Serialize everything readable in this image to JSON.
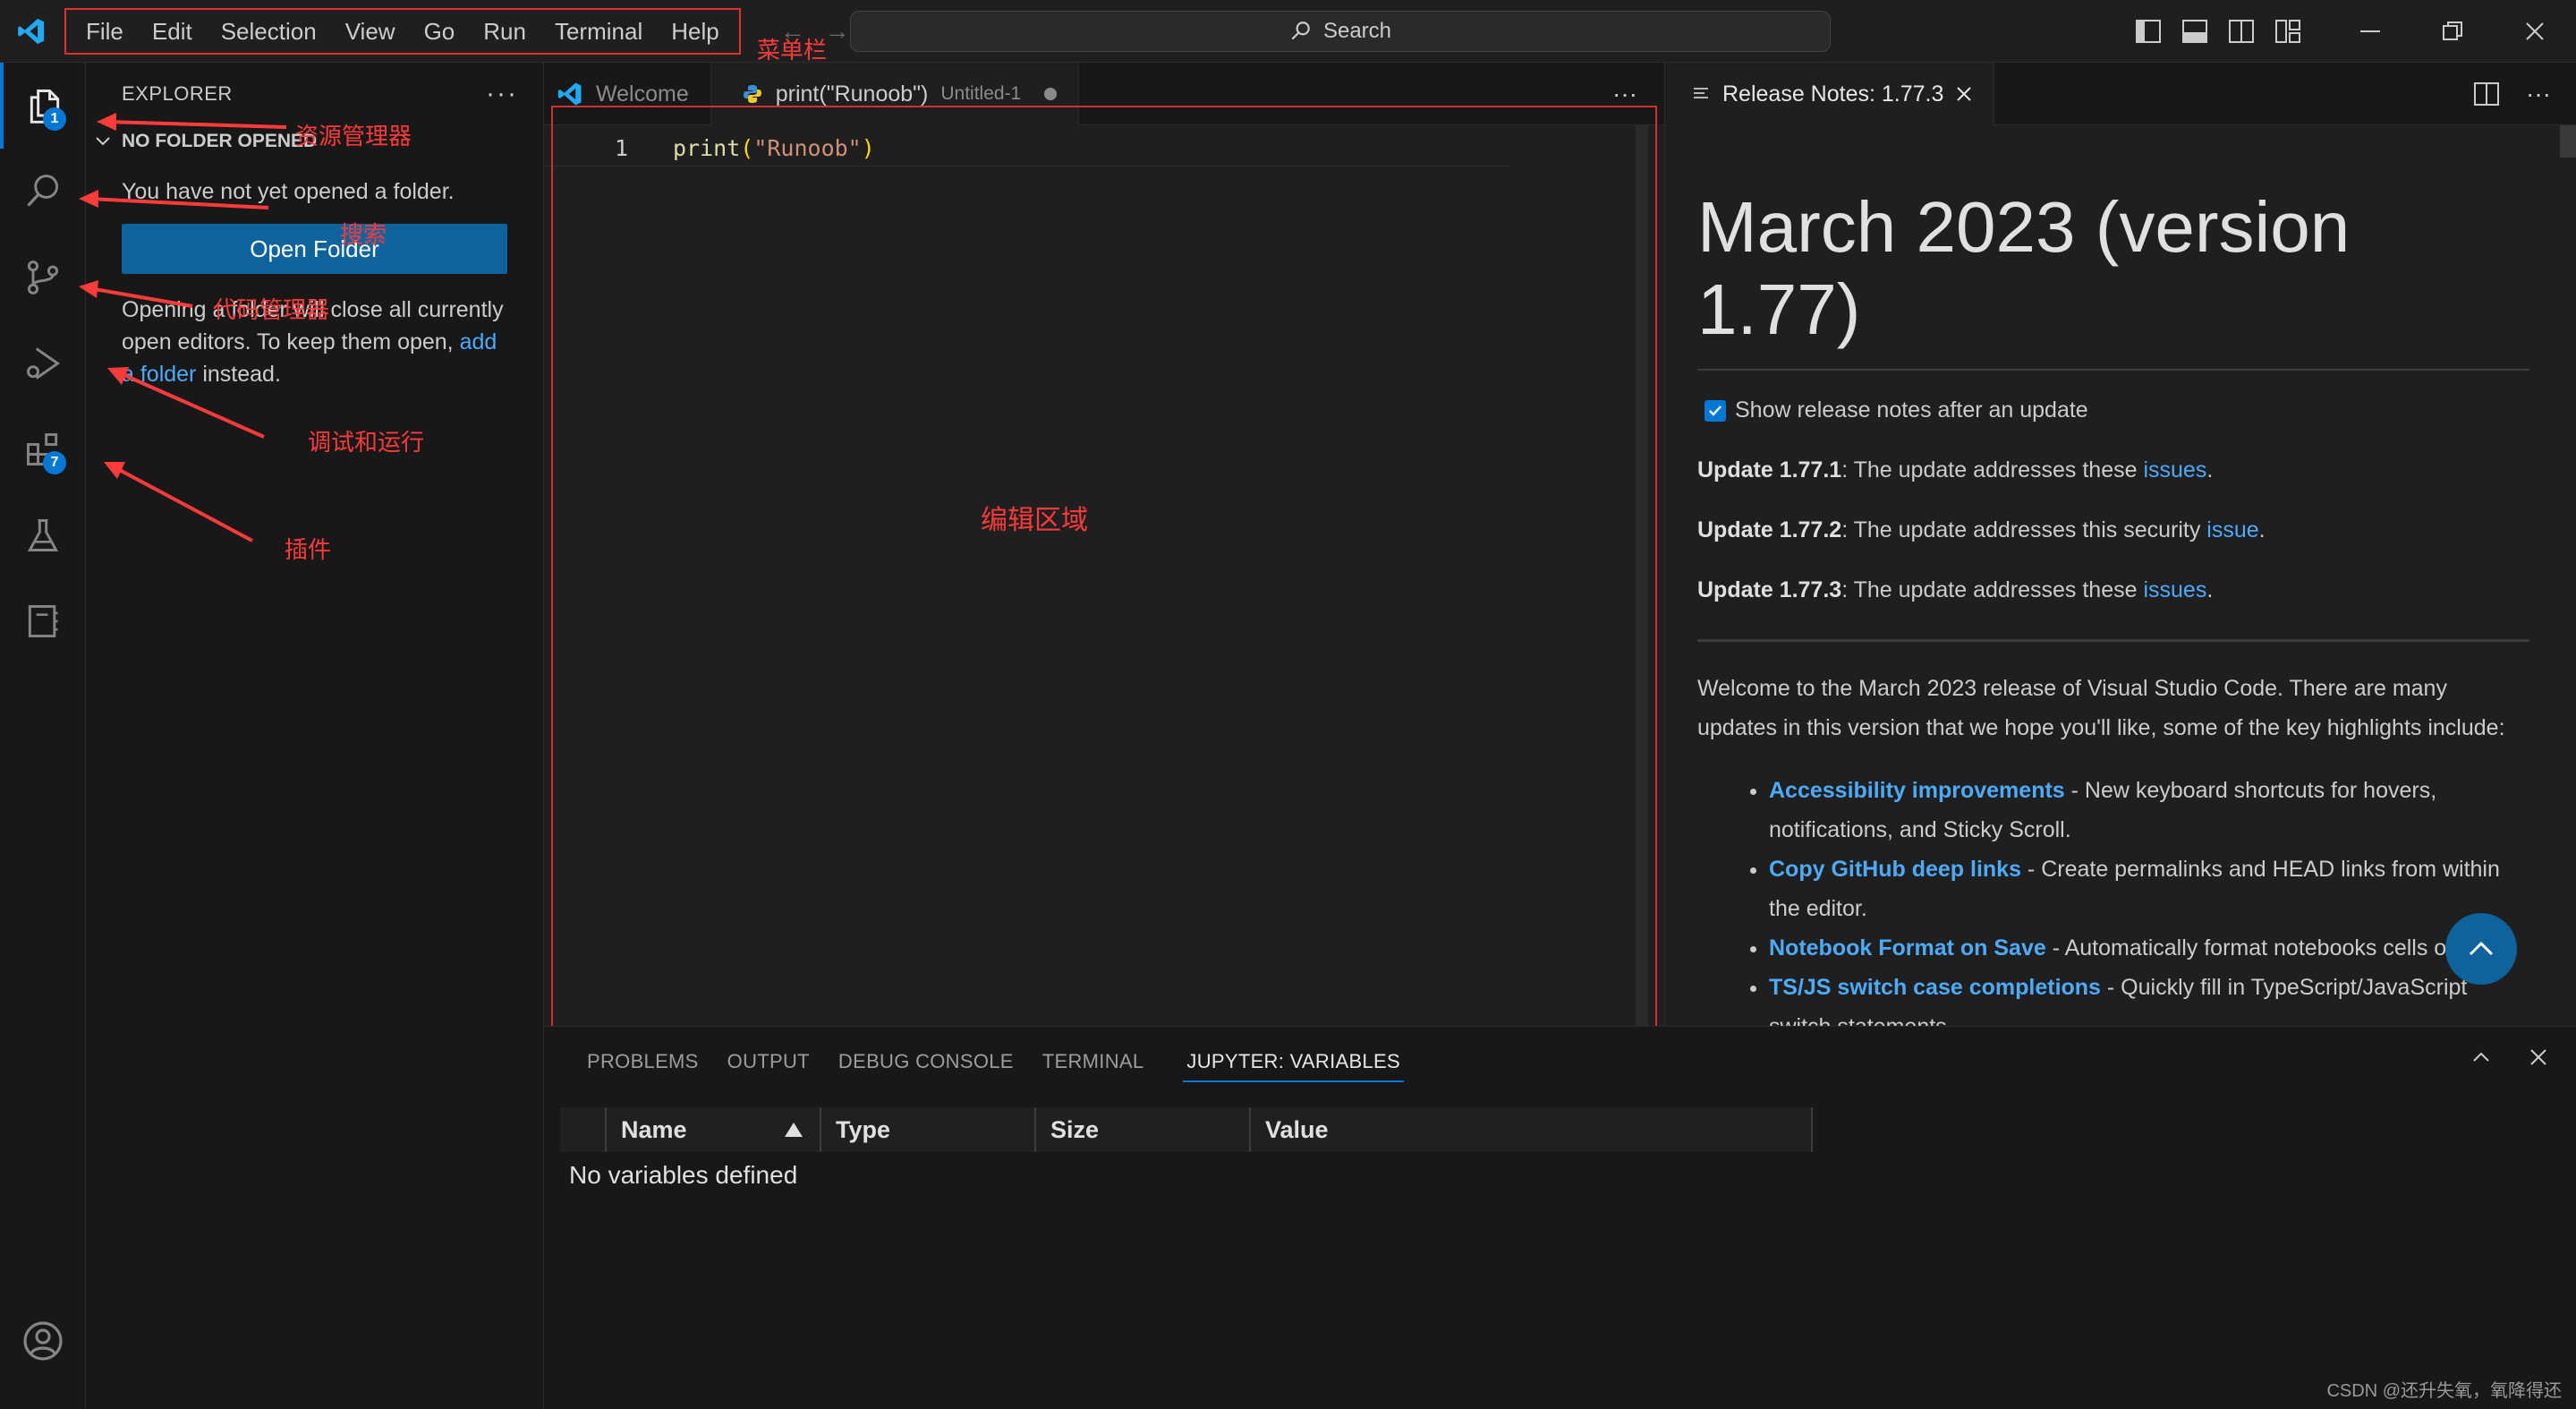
{
  "menu": {
    "items": [
      "File",
      "Edit",
      "Selection",
      "View",
      "Go",
      "Run",
      "Terminal",
      "Help"
    ]
  },
  "search": {
    "label": "Search"
  },
  "activity_bar": {
    "explorer_badge": "1",
    "extensions_badge": "7"
  },
  "sidebar": {
    "title": "EXPLORER",
    "section": "NO FOLDER OPENED",
    "message": "You have not yet opened a folder.",
    "open_folder_button": "Open Folder",
    "para_1": "Opening a folder will close all currently open editors. To keep them open, ",
    "para_link": "add a folder",
    "para_2": " instead."
  },
  "editor": {
    "tabs": [
      {
        "label": "Welcome"
      },
      {
        "label": "print(\"Runoob\")",
        "description": "Untitled-1"
      }
    ],
    "line_number": "1",
    "code_fn": "print",
    "code_open": "(",
    "code_str": "\"Runoob\"",
    "code_close": ")"
  },
  "release_notes": {
    "tab_label": "Release Notes: 1.77.3",
    "title": "March 2023 (version 1.77)",
    "checkbox_label": "Show release notes after an update",
    "updates": [
      {
        "version": "Update 1.77.1",
        "text": ": The update addresses these ",
        "link": "issues",
        "end": "."
      },
      {
        "version": "Update 1.77.2",
        "text": ": The update addresses this security ",
        "link": "issue",
        "end": "."
      },
      {
        "version": "Update 1.77.3",
        "text": ": The update addresses these ",
        "link": "issues",
        "end": "."
      }
    ],
    "intro": "Welcome to the March 2023 release of Visual Studio Code. There are many updates in this version that we hope you'll like, some of the key highlights include:",
    "highlights": [
      {
        "title": "Accessibility improvements",
        "text": " - New keyboard shortcuts for hovers, notifications, and Sticky Scroll."
      },
      {
        "title": "Copy GitHub deep links",
        "text": " - Create permalinks and HEAD links from within the editor."
      },
      {
        "title": "Notebook Format on Save",
        "text": " - Automatically format notebooks cells on save."
      },
      {
        "title": "TS/JS switch case completions",
        "text": " - Quickly fill in TypeScript/JavaScript switch statements."
      }
    ]
  },
  "panel": {
    "tabs": [
      "PROBLEMS",
      "OUTPUT",
      "DEBUG CONSOLE",
      "TERMINAL",
      "JUPYTER: VARIABLES"
    ],
    "columns": [
      "Name",
      "Type",
      "Size",
      "Value"
    ],
    "empty_message": "No variables defined"
  },
  "annotations": {
    "menubar": "菜单栏",
    "explorer": "资源管理器",
    "search": "搜索",
    "source_control": "代码管理器",
    "debug": "调试和运行",
    "extensions": "插件",
    "editor_area": "编辑区域"
  },
  "watermark": "CSDN @还升失氧，氧降得还",
  "colors": {
    "accent": "#0078d4",
    "button": "#0e639c",
    "link": "#4daafc",
    "annotation": "#ff3b3b"
  }
}
